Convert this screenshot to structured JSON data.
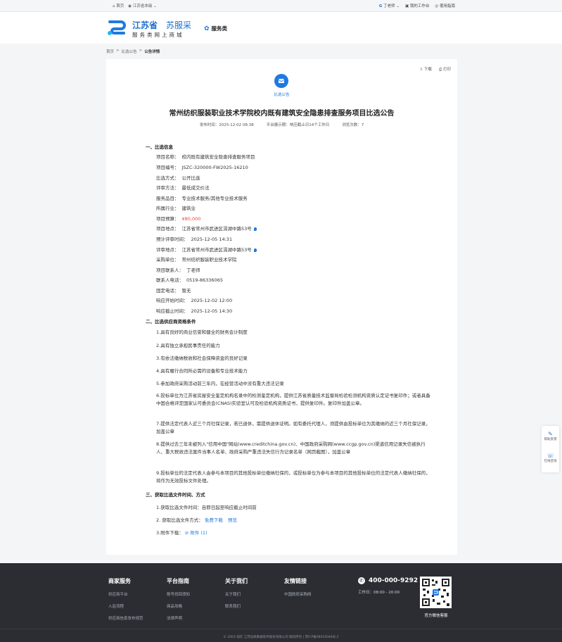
{
  "topbar": {
    "home": "首页",
    "location": "江苏省本级",
    "user": "丁老师",
    "workbench": "我的工作台",
    "guide": "使用指南"
  },
  "brand": {
    "name": "江苏省",
    "name2": "苏服采",
    "slogan": "服务类网上商城",
    "category": "服务类"
  },
  "breadcrumb": [
    "首页",
    ">",
    "比选公告",
    ">",
    "公告详情"
  ],
  "tools": {
    "download": "下载",
    "print": "打印"
  },
  "notice": {
    "badge": "比选公告",
    "title": "常州纺织服装职业技术学院校内既有建筑安全隐患排查服务项目比选公告",
    "meta": {
      "published": "发布时间：2025-12-02 08:38",
      "platform": "平台展示期：响应截止日14个工作日",
      "views": "浏览次数：7"
    }
  },
  "section1": {
    "title": "一、比选信息",
    "rows": [
      {
        "label": "项目名称：",
        "value": "校内既有建筑安全隐患排查服务项目"
      },
      {
        "label": "项目编号：",
        "value": "JSZC-320000-FW2025-16210"
      },
      {
        "label": "比选方式：",
        "value": "公开比选"
      },
      {
        "label": "评审方法：",
        "value": "最低成交价法"
      },
      {
        "label": "服务品目：",
        "value": "专业技术服务/其他专业技术服务"
      },
      {
        "label": "所属行业：",
        "value": "建筑业"
      },
      {
        "label": "项目预算：",
        "value": "¥80,000"
      },
      {
        "label": "项目地点：",
        "value": "江苏省常州市武进区滆湖中路53号"
      },
      {
        "label": "预计评审时间：",
        "value": "2025-12-05 14:31"
      },
      {
        "label": "评审地点：",
        "value": "江苏省常州市武进区滆湖中路53号"
      },
      {
        "label": "采购单位：",
        "value": "常州纺织服装职业技术学院"
      },
      {
        "label": "项目联系人：",
        "value": "丁老师"
      },
      {
        "label": "联系人电话：",
        "value": "0519-86336065"
      },
      {
        "label": "固定电话：",
        "value": "暂无"
      },
      {
        "label": "响应开始时间：",
        "value": "2025-12-02 12:00"
      },
      {
        "label": "响应截止时间：",
        "value": "2025-12-05 14:30"
      }
    ]
  },
  "section2": {
    "title": "二、比选供应商资格条件",
    "items": [
      "1.具有良好的商业信誉和健全的财务会计制度",
      "2.具有独立承担民事责任的能力",
      "3.有依法缴纳税收和社会保障资金的良好记录",
      "4.具有履行合同所必需的设备和专业技术能力",
      "5.参加政府采购活动前三年内，在经营活动中没有重大违法记录",
      "6.投标单位为江苏省房屋安全鉴定机构名录中的检测鉴定机构，提供江苏省质量技术监督局检验检测机构资质认定证书复印件；或者具备中国合格评定国家认可委员会(CNAS)实验室认可及检验机构资质证书，提供复印件。复印件加盖公章。",
      "7.提供法定代表人近三个月社保记录，若已退休，需提供退休证明。如有委托代理人，须提供由投标单位为其缴纳的近三个月社保记录，加盖公章",
      "8.提供过去三年未被列入\"信用中国\"网站(www.creditchina.gov.cn)、中国政府采购网(www.ccgp.gov.cn)渠道信用记录失信被执行人、重大税收违法案件当事人名单、政府采购严重违法失信行为记录名单（网页截图），加盖公章",
      "9.投标单位的法定代表人由参与本项目的其他投标单位缴纳社保的，或投标单位为参与本项目的其他投标单位的法定代表人缴纳社保的，将作为无效投标文件处理。"
    ]
  },
  "section3": {
    "title": "三、获取比选文件时间、方式",
    "time": "1.获取比选文件时间：自即日起至响应截止时间前",
    "method_label": "2. 获取比选文件方式：",
    "free_download": "免费下载",
    "preview": "预览",
    "attachment_label": "3.附件下载：",
    "attachment": "附件 (1)"
  },
  "floating": {
    "help": "帮助反馈",
    "online": "在线咨询"
  },
  "footer": {
    "cols": [
      {
        "title": "商家服务",
        "items": [
          "供应商平台",
          "入驻流程",
          "供应商信息发布规范"
        ]
      },
      {
        "title": "平台指南",
        "items": [
          "账号找回须知",
          "商品攻略",
          "法律声明"
        ]
      },
      {
        "title": "关于我们",
        "items": [
          "关于我们",
          "联系我们"
        ]
      },
      {
        "title": "友情链接",
        "items": [
          "中国政府采购网"
        ]
      }
    ],
    "phone": "400-000-9292",
    "hours": "工作日：08:00 - 20:00",
    "qr_caption": "官方微信客服",
    "copyright": "© 2003-现在 江苏远帆数据软件股份有限公司 版权所有 | 苏ICP备08016048号-2"
  },
  "colors": {
    "accent": "#1f7ae0",
    "price": "#e3453b",
    "footer_bg": "#2b2d33"
  }
}
